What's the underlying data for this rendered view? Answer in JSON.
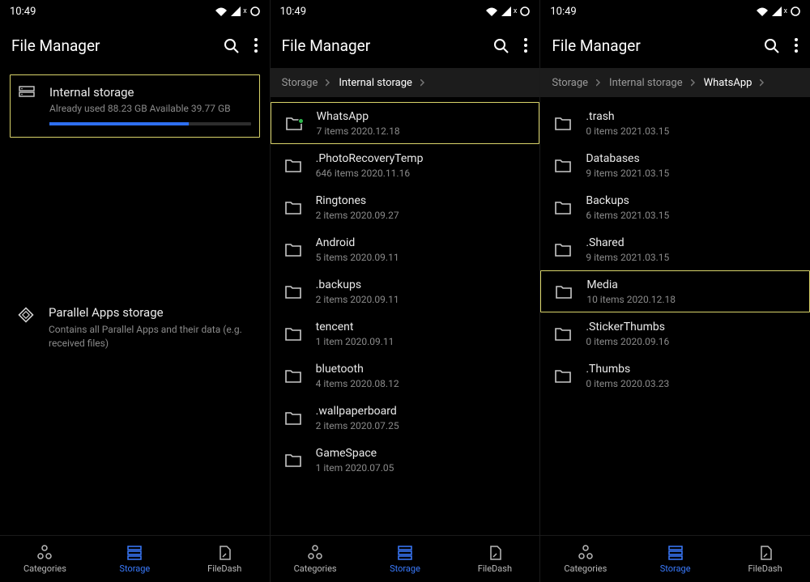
{
  "status": {
    "time": "10:49"
  },
  "appbar": {
    "title": "File Manager"
  },
  "nav": {
    "categories": "Categories",
    "storage": "Storage",
    "filedash": "FileDash"
  },
  "screen1": {
    "internal": {
      "title": "Internal storage",
      "sub": "Already used 88.23 GB   Available 39.77 GB",
      "fill_pct": 69
    },
    "parallel": {
      "title": "Parallel Apps storage",
      "sub": "Contains all Parallel Apps and their data (e.g. received files)"
    }
  },
  "screen2": {
    "breadcrumb": [
      "Storage",
      "Internal storage"
    ],
    "active_idx": 1,
    "items": [
      {
        "name": "WhatsApp",
        "sub": "7 items   2020.12.18",
        "badge": true,
        "highlight": true
      },
      {
        "name": ".PhotoRecoveryTemp",
        "sub": "646 items   2020.11.16"
      },
      {
        "name": "Ringtones",
        "sub": "2 items   2020.09.27"
      },
      {
        "name": "Android",
        "sub": "5 items   2020.09.11"
      },
      {
        "name": ".backups",
        "sub": "2 items   2020.09.11"
      },
      {
        "name": "tencent",
        "sub": "1 item   2020.09.11"
      },
      {
        "name": "bluetooth",
        "sub": "4 items   2020.08.12"
      },
      {
        "name": ".wallpaperboard",
        "sub": "2 items   2020.07.25"
      },
      {
        "name": "GameSpace",
        "sub": "1 item   2020.07.05"
      }
    ]
  },
  "screen3": {
    "breadcrumb": [
      "Storage",
      "Internal storage",
      "WhatsApp"
    ],
    "active_idx": 2,
    "items": [
      {
        "name": ".trash",
        "sub": "0 items   2021.03.15"
      },
      {
        "name": "Databases",
        "sub": "9 items   2021.03.15"
      },
      {
        "name": "Backups",
        "sub": "6 items   2021.03.15"
      },
      {
        "name": ".Shared",
        "sub": "9 items   2021.03.15"
      },
      {
        "name": "Media",
        "sub": "10 items   2020.12.18",
        "highlight": true
      },
      {
        "name": ".StickerThumbs",
        "sub": "0 items   2020.09.16"
      },
      {
        "name": ".Thumbs",
        "sub": "0 items   2020.03.23"
      }
    ]
  }
}
